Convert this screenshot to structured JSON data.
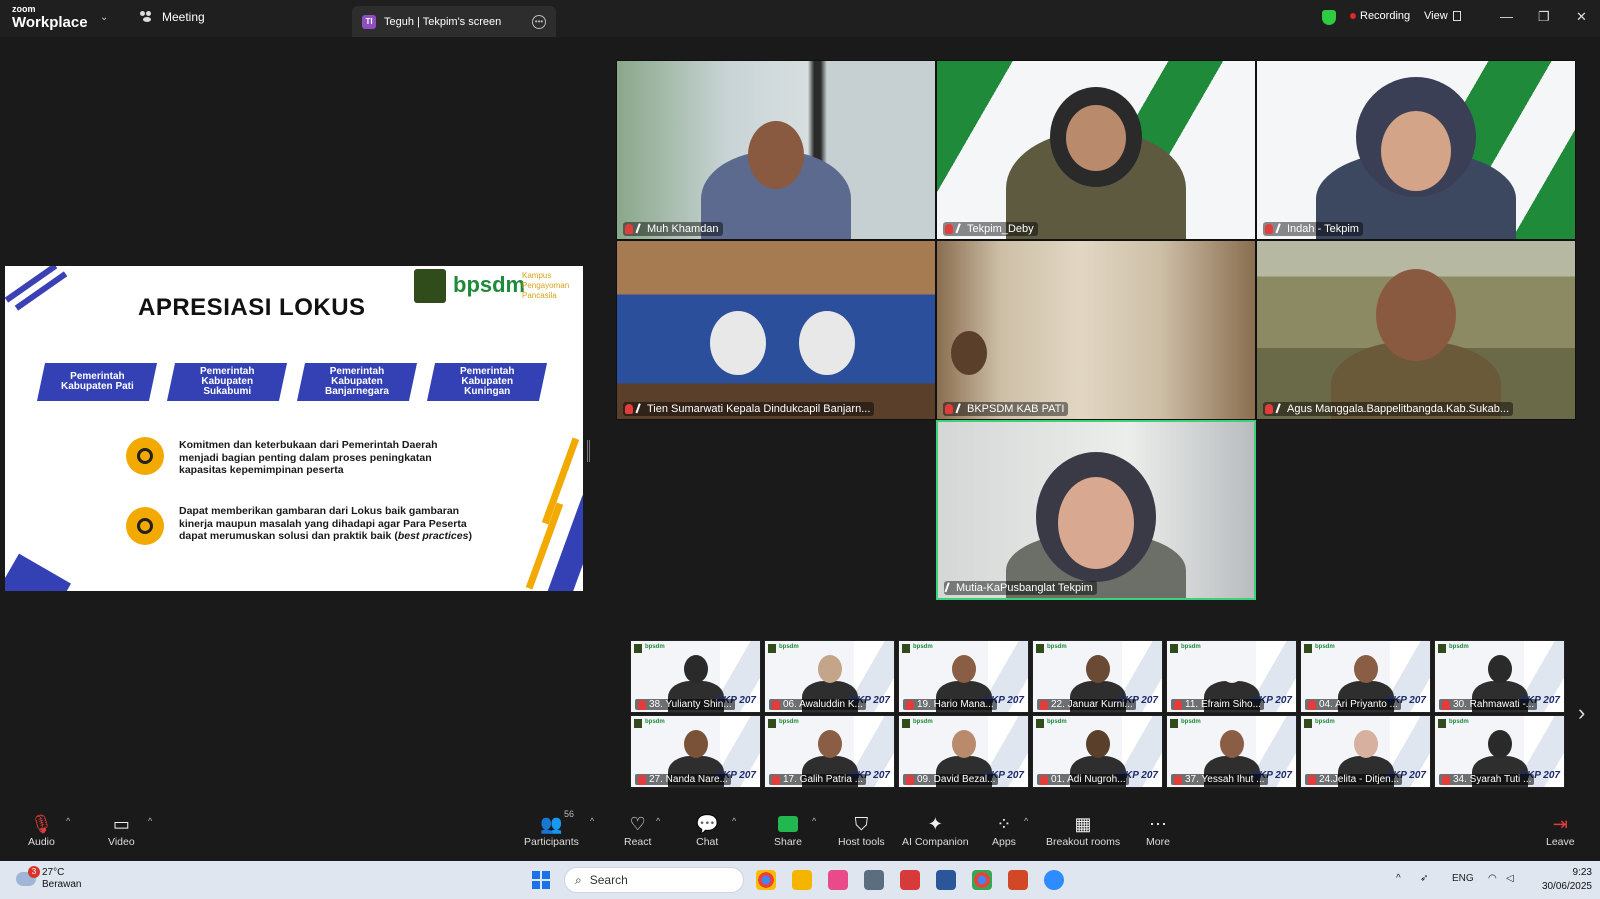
{
  "titlebar": {
    "brand_small": "zoom",
    "brand_big": "Workplace",
    "meeting_tab": "Meeting",
    "screen_tab_badge": "TI",
    "screen_tab": "Teguh | Tekpim's screen",
    "recording": "Recording",
    "view": "View"
  },
  "slide": {
    "title": "APRESIASI LOKUS",
    "logo_text": "bpsdm",
    "logo_sub": "Kampus\nPengayoman\nPancasila",
    "pills": [
      "Pemerintah\nKabupaten Pati",
      "Pemerintah\nKabupaten\nSukabumi",
      "Pemerintah\nKabupaten\nBanjarnegara",
      "Pemerintah\nKabupaten\nKuningan"
    ],
    "bullet1": "Komitmen dan keterbukaan dari Pemerintah Daerah menjadi bagian penting dalam proses peningkatan kapasitas kepemimpinan peserta",
    "bullet2_main": "Dapat memberikan gambaran dari Lokus baik gambaran kinerja maupun masalah yang dihadapi agar Para Peserta dapat merumuskan solusi dan praktik baik (",
    "bullet2_italic": "best practices",
    "bullet2_end": ")"
  },
  "participants_main": [
    {
      "name": "Muh Khamdan"
    },
    {
      "name": "Tekpim_Deby"
    },
    {
      "name": "Indah - Tekpim"
    },
    {
      "name": "Tien Sumarwati Kepala Dindukcapil Banjarn..."
    },
    {
      "name": "BKPSDM KAB PATI"
    },
    {
      "name": "Agus Manggala.Bappelitbangda.Kab.Sukab..."
    },
    {
      "name": "Mutia-KaPusbanglat Tekpim"
    }
  ],
  "gallery": [
    "38. Yulianty Shin...",
    "06. Awaluddin K...",
    "19. Hario Mana...",
    "22. Januar Kurni...",
    "11. Efraim Siho...",
    "04. Ari Priyanto ...",
    "30. Rahmawati -...",
    "27. Nanda Nare...",
    "17. Galih Patria ...",
    "09. David Bezal...",
    "01. Adi Nugroh...",
    "37. Yessah Ihut ...",
    "24.Jelita - Ditjen...",
    "34. Syarah Tuti ..."
  ],
  "gallery_badge": "BKP 207",
  "gallery_logo": "bpsdm",
  "toolbar": {
    "audio": "Audio",
    "video": "Video",
    "participants": "Participants",
    "participants_count": "56",
    "react": "React",
    "chat": "Chat",
    "share": "Share",
    "host_tools": "Host tools",
    "ai_companion": "AI Companion",
    "apps": "Apps",
    "breakout": "Breakout rooms",
    "more": "More",
    "leave": "Leave"
  },
  "taskbar": {
    "weather_badge": "3",
    "temp": "27°C",
    "weather": "Berawan",
    "search_placeholder": "Search",
    "lang": "ENG",
    "time": "9:23",
    "date": "30/06/2025"
  }
}
